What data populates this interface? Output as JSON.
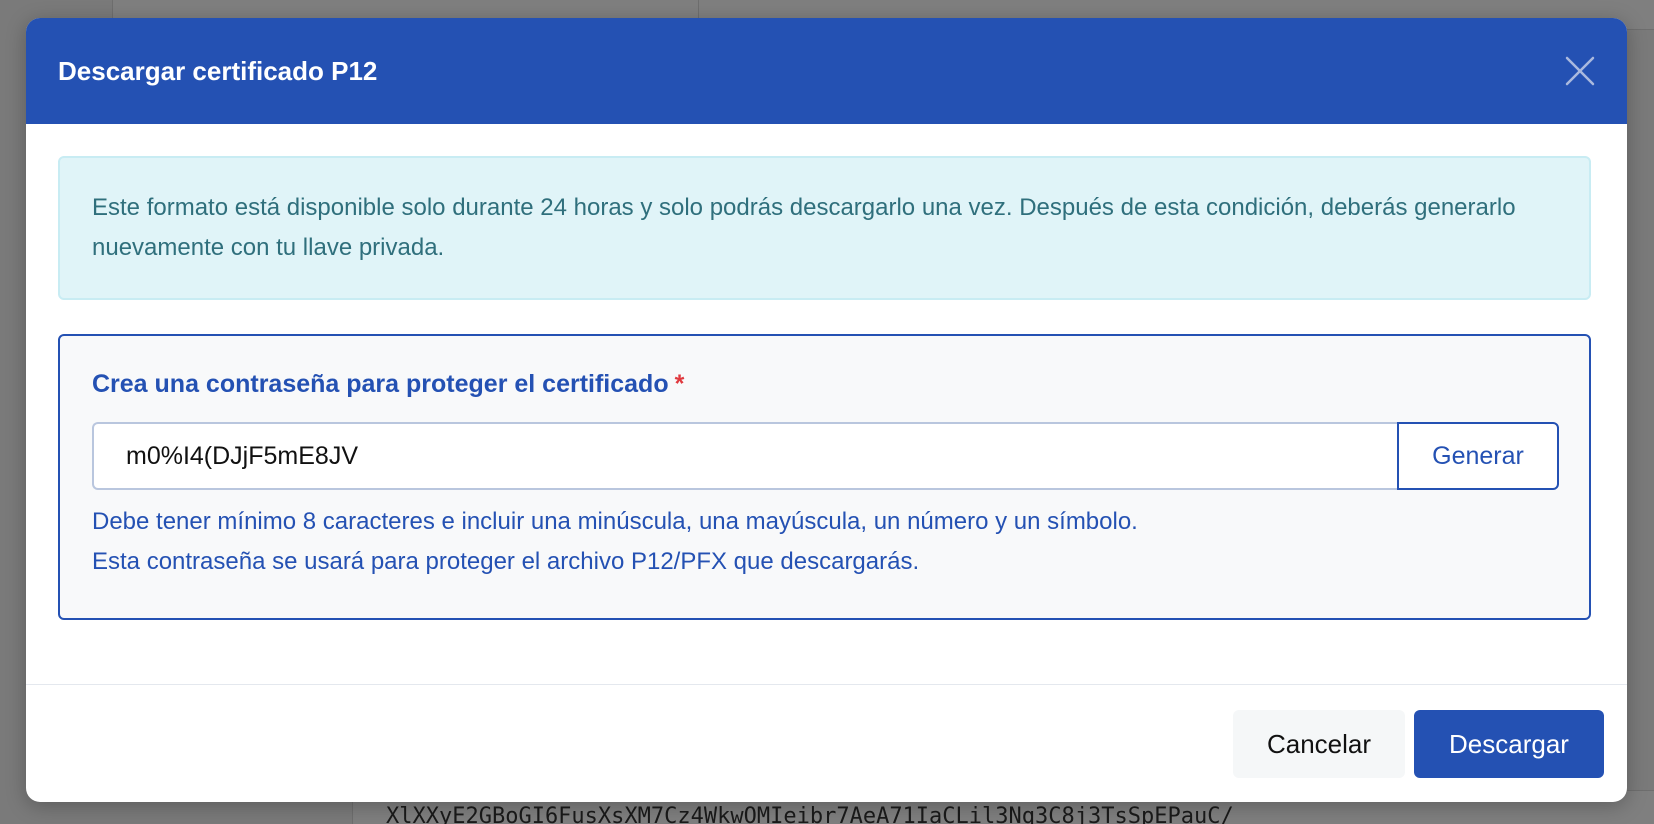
{
  "colors": {
    "primary": "#2451b3",
    "info_bg": "#e0f4f8",
    "info_text": "#2f6f7c",
    "form_bg": "#f8f9fa",
    "required": "#e0393e"
  },
  "background": {
    "code_snippet": "XlXXyE2GBoGI6FusXsXM7Cz4WkwOMIeibr7AeA71IaCLil3Nq3C8j3TsSpEPauC/"
  },
  "modal": {
    "title": "Descargar certificado P12",
    "close_icon": "close-icon",
    "info_message": "Este formato está disponible solo durante 24 horas y solo podrás descargarlo una vez. Después de esta condición, deberás generarlo nuevamente con tu llave privada.",
    "form": {
      "label": "Crea una contraseña para proteger el certificado",
      "required_mark": "*",
      "password_value": "m0%I4(DJjF5mE8JV",
      "generate_label": "Generar",
      "help_line1": "Debe tener mínimo 8 caracteres e incluir una minúscula, una mayúscula, un número y un símbolo.",
      "help_line2": "Esta contraseña se usará para proteger el archivo P12/PFX que descargarás."
    },
    "footer": {
      "cancel_label": "Cancelar",
      "download_label": "Descargar"
    }
  }
}
